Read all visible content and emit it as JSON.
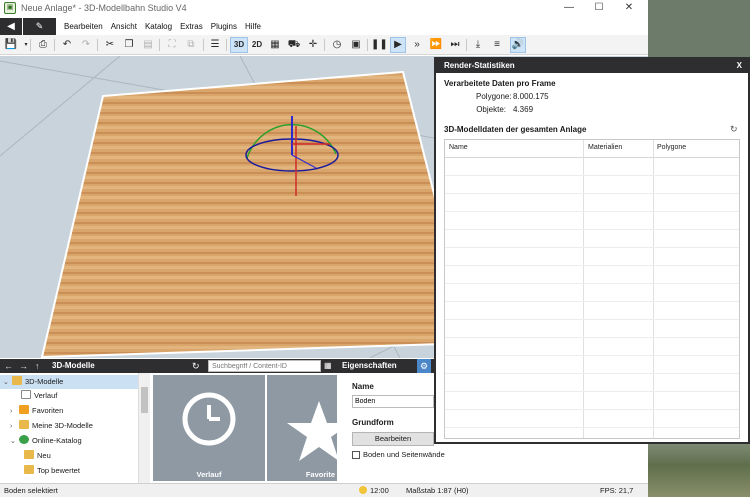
{
  "window": {
    "title": "Neue Anlage* - 3D-Modellbahn Studio V4",
    "minimize_label": "—",
    "maximize_label": "☐",
    "close_label": "✕"
  },
  "menu": {
    "back_icon": "◀",
    "edit_icon": "✎",
    "items": [
      "Bearbeiten",
      "Ansicht",
      "Katalog",
      "Extras",
      "Plugins",
      "Hilfe"
    ]
  },
  "toolbar": {
    "mode_3d": "3D",
    "mode_2d": "2D"
  },
  "render_stats": {
    "title": "Render-Statistiken",
    "close_label": "X",
    "frame_heading": "Verarbeitete Daten pro Frame",
    "polygons_label": "Polygone:",
    "polygons_value": "8.000.175",
    "objects_label": "Objekte:",
    "objects_value": "4.369",
    "model_heading": "3D-Modelldaten der gesamten Anlage",
    "columns": [
      "Name",
      "Materialien",
      "Polygone"
    ]
  },
  "models_panel": {
    "title": "3D-Modelle",
    "search_placeholder": "Suchbegriff / Content-ID",
    "tree": [
      {
        "label": "3D-Modelle",
        "selected": true
      },
      {
        "label": "Verlauf"
      },
      {
        "label": "Favoriten"
      },
      {
        "label": "Meine 3D-Modelle"
      },
      {
        "label": "Online-Katalog"
      },
      {
        "label": "Neu"
      },
      {
        "label": "Top bewertet"
      }
    ],
    "tiles": [
      "Verlauf",
      "Favorite"
    ]
  },
  "properties": {
    "title": "Eigenschaften",
    "name_label": "Name",
    "name_value": "Boden",
    "shape_label": "Grundform",
    "edit_button": "Bearbeiten",
    "checkbox_label": "Boden und Seitenwände"
  },
  "status": {
    "selection": "Boden selektiert",
    "time": "12:00",
    "scale": "Maßstab 1:87 (H0)",
    "fps": "FPS: 21,7"
  },
  "colors": {
    "dark_header": "#2e2e30",
    "accent_blue": "#4a86c8",
    "viewport_sky": "#c9d3dc",
    "wood_plate": "#d9a56a"
  }
}
